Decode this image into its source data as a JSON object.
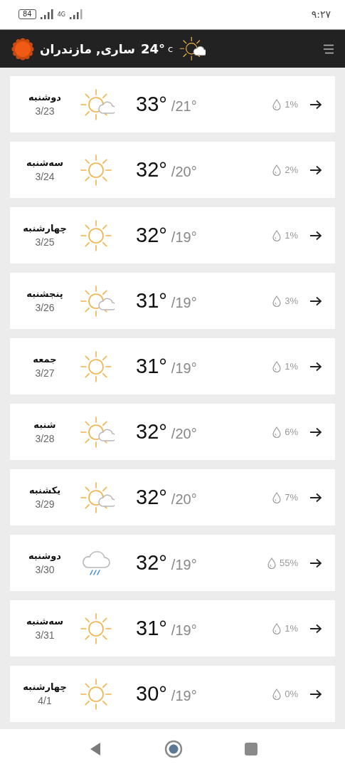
{
  "status_bar": {
    "battery": "84",
    "network": "4G",
    "time": "۹:۲۷"
  },
  "header": {
    "city": "ساری, مازندران",
    "temperature": "24°",
    "unit": "c",
    "condition": {
      "kind": "partly"
    }
  },
  "days": [
    {
      "day": "دوشنبه",
      "date": "3/23",
      "kind": "partly",
      "high": "33°",
      "low": "/21°",
      "precipitation": "1%"
    },
    {
      "day": "سه‌شنبه",
      "date": "3/24",
      "kind": "sunny",
      "high": "32°",
      "low": "/20°",
      "precipitation": "2%"
    },
    {
      "day": "چهارشنبه",
      "date": "3/25",
      "kind": "sunny",
      "high": "32°",
      "low": "/19°",
      "precipitation": "1%"
    },
    {
      "day": "پنجشنبه",
      "date": "3/26",
      "kind": "partly",
      "high": "31°",
      "low": "/19°",
      "precipitation": "3%"
    },
    {
      "day": "جمعه",
      "date": "3/27",
      "kind": "sunny",
      "high": "31°",
      "low": "/19°",
      "precipitation": "1%"
    },
    {
      "day": "شنبه",
      "date": "3/28",
      "kind": "partly",
      "high": "32°",
      "low": "/20°",
      "precipitation": "6%"
    },
    {
      "day": "یکشنبه",
      "date": "3/29",
      "kind": "partly",
      "high": "32°",
      "low": "/20°",
      "precipitation": "7%"
    },
    {
      "day": "دوشنبه",
      "date": "3/30",
      "kind": "rain",
      "high": "32°",
      "low": "/19°",
      "precipitation": "55%"
    },
    {
      "day": "سه‌شنبه",
      "date": "3/31",
      "kind": "sunny",
      "high": "31°",
      "low": "/19°",
      "precipitation": "1%"
    },
    {
      "day": "چهارشنبه",
      "date": "4/1",
      "kind": "sunny",
      "high": "30°",
      "low": "/19°",
      "precipitation": "0%"
    }
  ]
}
